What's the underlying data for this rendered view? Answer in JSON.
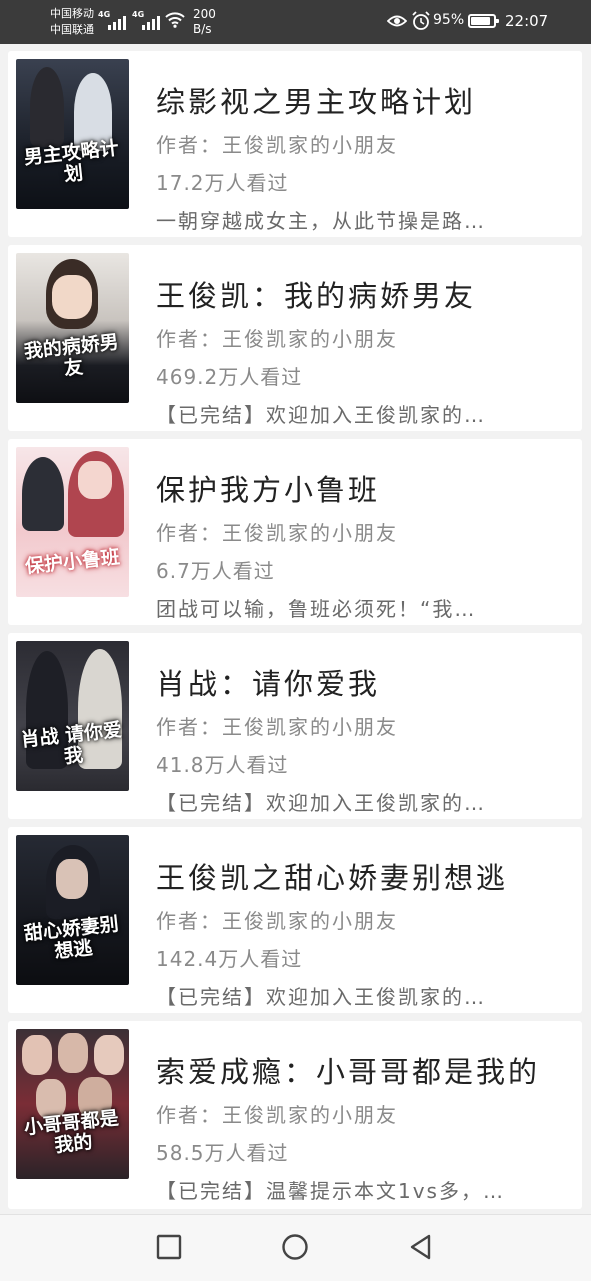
{
  "status_bar": {
    "carrier_1": "中国移动",
    "carrier_2": "中国联通",
    "network_1": "4G",
    "network_2": "4G",
    "speed_value": "200",
    "speed_unit": "B/s",
    "battery": "95%",
    "battery_level": 0.95,
    "time": "22:07",
    "icons": [
      "signal-icon",
      "wifi-icon",
      "eye-icon",
      "alarm-icon",
      "battery-icon"
    ]
  },
  "books": [
    {
      "title": "综影视之男主攻略计划",
      "author": "作者：王俊凯家的小朋友",
      "views": "17.2万人看过",
      "desc": "一朝穿越成女主，从此节操是路…",
      "cover_title": "男主攻略计划",
      "cover_color": "#1c2330"
    },
    {
      "title": "王俊凯：我的病娇男友",
      "author": "作者：王俊凯家的小朋友",
      "views": "469.2万人看过",
      "desc": "【已完结】欢迎加入王俊凯家的…",
      "cover_title": "我的病娇男友",
      "cover_color": "#2a2f3a"
    },
    {
      "title": "保护我方小鲁班",
      "author": "作者：王俊凯家的小朋友",
      "views": "6.7万人看过",
      "desc": "团战可以输，鲁班必须死！“我…",
      "cover_title": "保护小鲁班",
      "cover_color": "#f4d9dc"
    },
    {
      "title": "肖战：请你爱我",
      "author": "作者：王俊凯家的小朋友",
      "views": "41.8万人看过",
      "desc": "【已完结】欢迎加入王俊凯家的…",
      "cover_title": "肖战 请你爱我",
      "cover_color": "#3a3a40"
    },
    {
      "title": "王俊凯之甜心娇妻别想逃",
      "author": "作者：王俊凯家的小朋友",
      "views": "142.4万人看过",
      "desc": "【已完结】欢迎加入王俊凯家的…",
      "cover_title": "甜心娇妻别想逃",
      "cover_color": "#14161c"
    },
    {
      "title": "索爱成瘾：小哥哥都是我的",
      "author": "作者：王俊凯家的小朋友",
      "views": "58.5万人看过",
      "desc": "【已完结】温馨提示本文1vs多，…",
      "cover_title": "小哥哥都是我的",
      "cover_color": "#6b2a30"
    }
  ],
  "nav": {
    "icons": [
      "recent-apps-icon",
      "home-icon",
      "back-icon"
    ]
  }
}
